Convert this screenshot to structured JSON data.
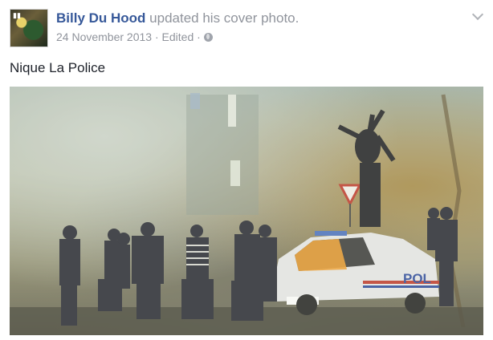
{
  "post": {
    "author": "Billy Du Hood",
    "action": " updated his cover photo.",
    "date": "24 November 2013",
    "separator1": " · ",
    "edited": "Edited",
    "separator2": " · ",
    "privacy_icon": "globe-icon",
    "menu_icon": "chevron-down-icon",
    "text": "Nique La Police"
  },
  "photo": {
    "car_label": "POL"
  }
}
